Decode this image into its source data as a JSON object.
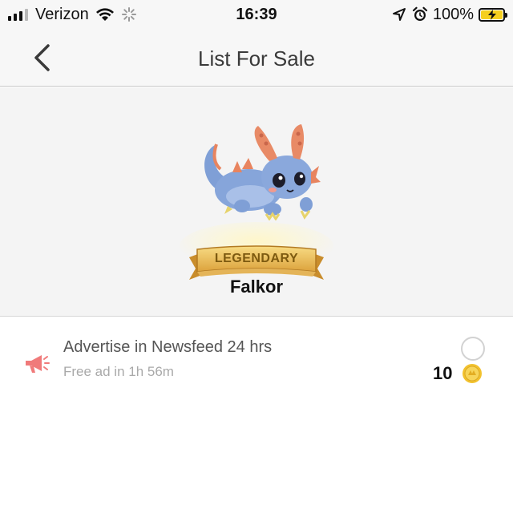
{
  "status_bar": {
    "carrier": "Verizon",
    "time": "16:39",
    "battery_percent": "100%",
    "icons": [
      "signal-icon",
      "wifi-icon",
      "loading-spinner-icon",
      "location-arrow-icon",
      "alarm-clock-icon",
      "battery-charging-icon"
    ]
  },
  "nav": {
    "title": "List For Sale",
    "back_icon": "chevron-left-icon"
  },
  "pet": {
    "rarity": "LEGENDARY",
    "name": "Falkor"
  },
  "option": {
    "icon": "megaphone-icon",
    "title": "Advertise in Newsfeed 24 hrs",
    "subtitle": "Free ad in 1h 56m",
    "price": "10",
    "currency_icon": "gold-coin-icon",
    "selected": false
  },
  "colors": {
    "accent_red": "#f07a7a",
    "coin_gold": "#f2c22e",
    "battery_yellow": "#f5cf1e",
    "banner_gold": "#e8b84a"
  }
}
